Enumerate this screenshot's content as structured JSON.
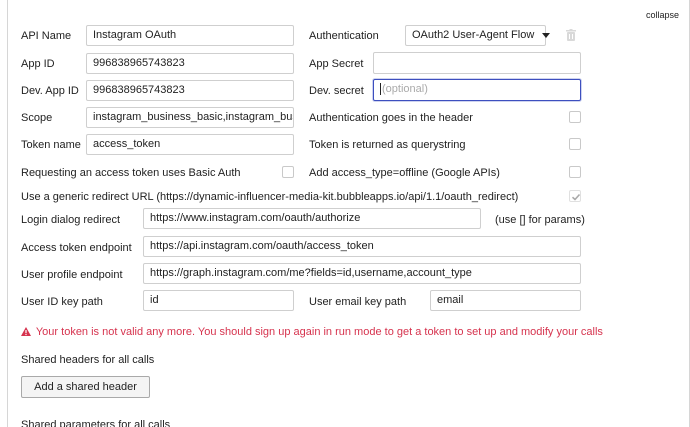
{
  "header": {
    "collapse_label": "collapse"
  },
  "fields": {
    "api_name": {
      "label": "API Name",
      "value": "Instagram OAuth"
    },
    "authentication": {
      "label": "Authentication",
      "value": "OAuth2 User-Agent Flow"
    },
    "app_id": {
      "label": "App ID",
      "value": "996838965743823"
    },
    "app_secret": {
      "label": "App Secret",
      "value": ""
    },
    "dev_app_id": {
      "label": "Dev. App ID",
      "value": "996838965743823"
    },
    "dev_secret": {
      "label": "Dev. secret",
      "placeholder": "(optional)"
    },
    "scope": {
      "label": "Scope",
      "value": "instagram_business_basic,instagram_busir"
    },
    "auth_in_header": {
      "label": "Authentication goes in the header",
      "checked": false
    },
    "token_name": {
      "label": "Token name",
      "value": "access_token"
    },
    "token_querystring": {
      "label": "Token is returned as querystring",
      "checked": false
    },
    "basic_auth": {
      "label": "Requesting an access token uses Basic Auth",
      "checked": false
    },
    "access_type_offline": {
      "label": "Add access_type=offline (Google APIs)",
      "checked": false
    },
    "generic_redirect": {
      "label": "Use a generic redirect URL (https://dynamic-influencer-media-kit.bubbleapps.io/api/1.1/oauth_redirect)",
      "checked": true
    },
    "login_dialog": {
      "label": "Login dialog redirect",
      "value": "https://www.instagram.com/oauth/authorize",
      "hint": "(use [] for params)"
    },
    "token_endpoint": {
      "label": "Access token endpoint",
      "value": "https://api.instagram.com/oauth/access_token"
    },
    "profile_endpoint": {
      "label": "User profile endpoint",
      "value": "https://graph.instagram.com/me?fields=id,username,account_type"
    },
    "user_id_path": {
      "label": "User ID key path",
      "value": "id"
    },
    "user_email_path": {
      "label": "User email key path",
      "value": "email"
    }
  },
  "warning": {
    "text": "Your token is not valid any more. You should sign up again in run mode to get a token to set up and modify your calls"
  },
  "shared_headers": {
    "label": "Shared headers for all calls",
    "button_label": "Add a shared header"
  },
  "shared_params": {
    "label": "Shared parameters for all calls"
  },
  "colors": {
    "warning": "#d6334e",
    "focus": "#3d4fbf"
  },
  "icons": {
    "delete": "trash-icon",
    "warning": "warning-triangle-icon",
    "check": "checkmark-icon"
  }
}
